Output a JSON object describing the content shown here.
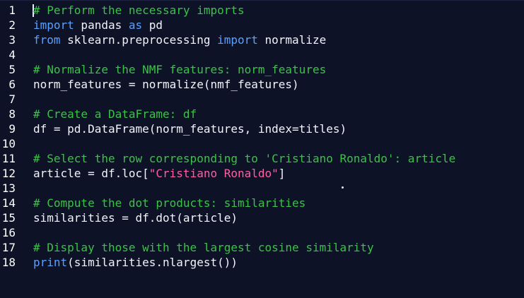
{
  "editor": {
    "lines": [
      {
        "n": "1",
        "parts": [
          {
            "t": "# Perform the necessary imports",
            "c": "cmt"
          }
        ]
      },
      {
        "n": "2",
        "parts": [
          {
            "t": "import",
            "c": "kw"
          },
          {
            "t": " pandas ",
            "c": "txt"
          },
          {
            "t": "as",
            "c": "kw"
          },
          {
            "t": " pd",
            "c": "txt"
          }
        ]
      },
      {
        "n": "3",
        "parts": [
          {
            "t": "from",
            "c": "kw"
          },
          {
            "t": " sklearn.preprocessing ",
            "c": "txt"
          },
          {
            "t": "import",
            "c": "kw"
          },
          {
            "t": " normalize",
            "c": "txt"
          }
        ]
      },
      {
        "n": "4",
        "parts": []
      },
      {
        "n": "5",
        "parts": [
          {
            "t": "# Normalize the NMF features: norm_features",
            "c": "cmt"
          }
        ]
      },
      {
        "n": "6",
        "parts": [
          {
            "t": "norm_features = normalize(nmf_features)",
            "c": "txt"
          }
        ]
      },
      {
        "n": "7",
        "parts": []
      },
      {
        "n": "8",
        "parts": [
          {
            "t": "# Create a DataFrame: df",
            "c": "cmt"
          }
        ]
      },
      {
        "n": "9",
        "parts": [
          {
            "t": "df = pd.DataFrame(norm_features, index=titles)",
            "c": "txt"
          }
        ]
      },
      {
        "n": "10",
        "parts": []
      },
      {
        "n": "11",
        "parts": [
          {
            "t": "# Select the row corresponding to 'Cristiano Ronaldo': article",
            "c": "cmt"
          }
        ]
      },
      {
        "n": "12",
        "parts": [
          {
            "t": "article = df.loc[",
            "c": "txt"
          },
          {
            "t": "\"Cristiano Ronaldo\"",
            "c": "str"
          },
          {
            "t": "]",
            "c": "txt"
          }
        ]
      },
      {
        "n": "13",
        "parts": []
      },
      {
        "n": "14",
        "parts": [
          {
            "t": "# Compute the dot products: similarities",
            "c": "cmt"
          }
        ]
      },
      {
        "n": "15",
        "parts": [
          {
            "t": "similarities = df.dot(article)",
            "c": "txt"
          }
        ]
      },
      {
        "n": "16",
        "parts": []
      },
      {
        "n": "17",
        "parts": [
          {
            "t": "# Display those with the largest cosine similarity",
            "c": "cmt"
          }
        ]
      },
      {
        "n": "18",
        "parts": [
          {
            "t": "print",
            "c": "kw"
          },
          {
            "t": "(similarities.nlargest())",
            "c": "txt"
          }
        ]
      }
    ],
    "colors": {
      "background": "#0d1226",
      "comment": "#3bc248",
      "keyword": "#5aa0ff",
      "string": "#ff5fa2",
      "text": "#f2f4fb",
      "line_number": "#ffffff"
    }
  }
}
